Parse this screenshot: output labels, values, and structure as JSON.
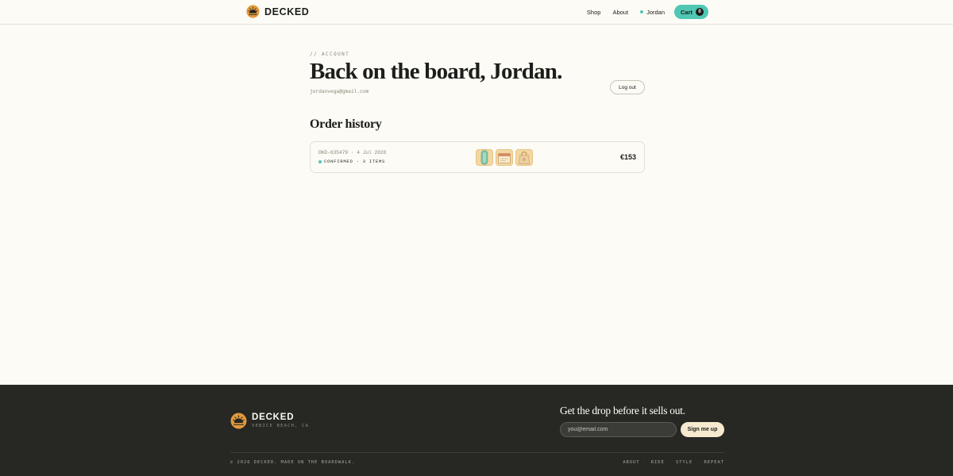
{
  "brand": {
    "name": "DECKED"
  },
  "nav": {
    "shop": "Shop",
    "about": "About",
    "user": "Jordan",
    "cart_label": "Cart",
    "cart_count": "0"
  },
  "account": {
    "eyebrow": "// ACCOUNT",
    "title": "Back on the board, Jordan.",
    "email": "jordanvega@gmail.com",
    "logout": "Log out"
  },
  "orders": {
    "title": "Order history",
    "items": [
      {
        "id_date": "DKD-635479 · 4 Jul 2026",
        "status": "CONFIRMED · 3 ITEMS",
        "total": "€153",
        "thumb_icons": [
          "skateboard-deck-icon",
          "wheel-box-icon",
          "tote-bag-icon"
        ]
      }
    ]
  },
  "footer": {
    "brand": "DECKED",
    "location": "VENICE BEACH, CA",
    "headline": "Get the drop before it sells out.",
    "email_placeholder": "you@email.com",
    "signup": "Sign me up",
    "copyright": "© 2026 DECKED. MADE ON THE BOARDWALK.",
    "links": [
      "ABOUT",
      "RIDE",
      "STYLE",
      "REPEAT"
    ]
  },
  "colors": {
    "accent": "#4fc7b3",
    "footer_bg": "#272724",
    "brand_orange": "#e39a3b",
    "background": "#fcfbf5"
  }
}
